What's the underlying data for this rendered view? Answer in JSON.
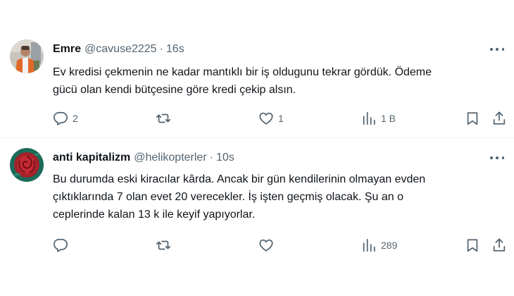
{
  "tweets": [
    {
      "name": "Emre",
      "handle": "@cavuse2225",
      "separator": "·",
      "time": "16s",
      "text": "Ev kredisi çekmenin ne kadar mantıklı bir iş oldugunu tekrar gördük. Ödeme\ngücü olan kendi bütçesine göre kredi çekip alsın.",
      "replies": "2",
      "retweets": "",
      "likes": "1",
      "views": "1 B"
    },
    {
      "name": "anti kapitalizm",
      "handle": "@helikopterler",
      "separator": "·",
      "time": "10s",
      "text": "Bu durumda eski kiracılar kârda.  Ancak bir gün kendilerinin olmayan evden\nçıktıklarında 7 olan evet 20 verecekler.  İş işten geçmiş olacak. Şu an o\nceplerinde kalan 13 k ile keyif yapıyorlar.",
      "replies": "",
      "retweets": "",
      "likes": "",
      "views": "289"
    }
  ],
  "colors": {
    "text": "#0f1419",
    "secondary": "#536471",
    "divider": "#eff3f4"
  },
  "icons": [
    "more-icon",
    "reply-icon",
    "retweet-icon",
    "like-icon",
    "views-icon",
    "bookmark-icon",
    "share-icon"
  ]
}
